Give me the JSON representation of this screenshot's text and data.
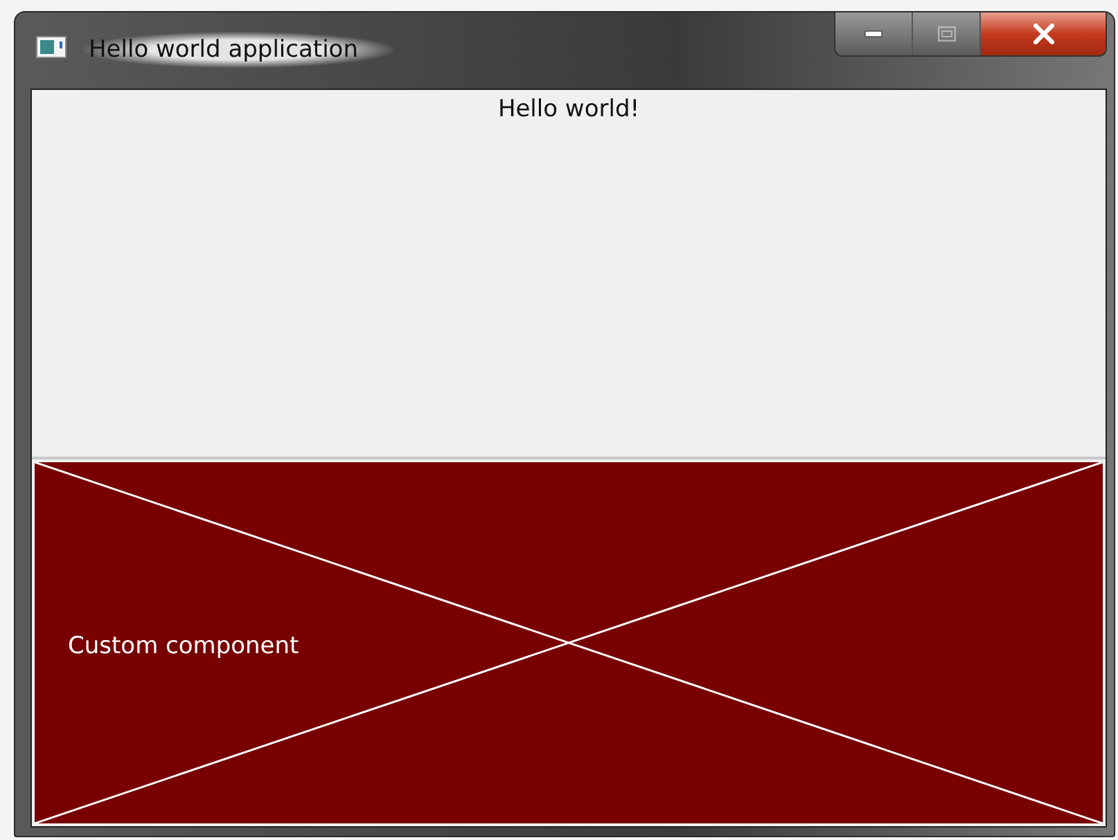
{
  "window": {
    "title": "Hello world application"
  },
  "caption_buttons": [
    {
      "kind": "minimize",
      "disabled": false
    },
    {
      "kind": "maximize",
      "disabled": true
    },
    {
      "kind": "close",
      "disabled": false
    }
  ],
  "label": {
    "text": "Hello world!"
  },
  "custom_component": {
    "text": "Custom component"
  }
}
